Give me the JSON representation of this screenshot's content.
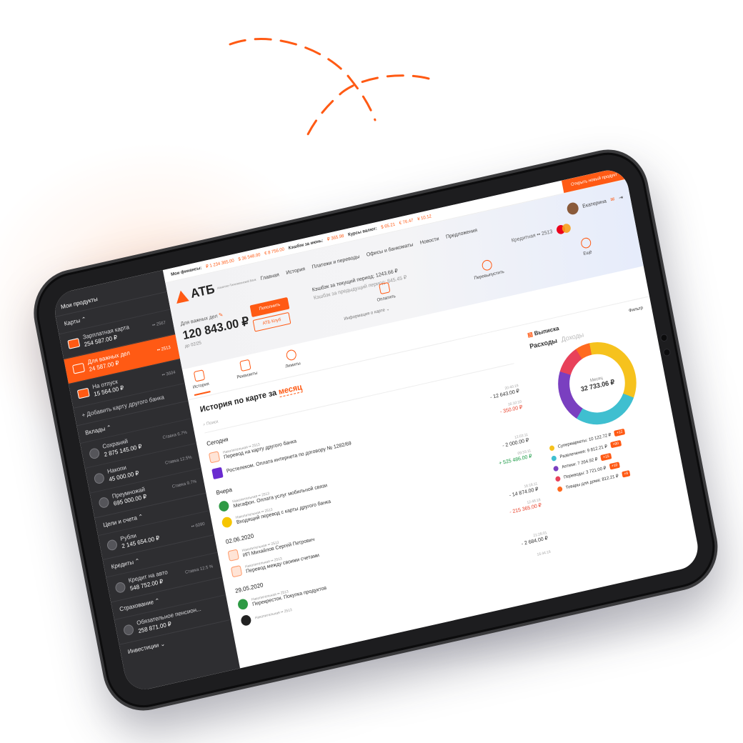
{
  "colors": {
    "accent": "#ff5a14",
    "positive": "#1b9a45",
    "negative": "#e8412b"
  },
  "topbar": {
    "finances_label": "Мои финансы:",
    "fin_1": "₽ 1 234 365.00",
    "fin_2": "$ 36 548.00",
    "fin_3": "€ 8 756.00",
    "cashback_label": "Кэшбэк за июнь:",
    "cashback_value": "₽ 365.98",
    "rates_label": "Курсы валют:",
    "rate_1": "$ 65.21",
    "rate_2": "€ 76.47",
    "rate_3": "¥ 10.12",
    "open_product": "Открыть новый продукт"
  },
  "nav": {
    "logo": "АТБ",
    "logo_sub": "Азиатско-Тихоокеанский Банк",
    "items": [
      "Главная",
      "История",
      "Платежи и переводы",
      "Офисы и банкоматы",
      "Новости",
      "Предложения"
    ],
    "user": "Екатерина"
  },
  "sidebar": {
    "title": "Мои продукты",
    "cards_header": "Карты",
    "cards": [
      {
        "name": "Зарплатная карта",
        "amount": "254 587.00 ₽",
        "num": "•• 2567"
      },
      {
        "name": "Для важных дел",
        "amount": "24 587.00 ₽",
        "num": "•• 2513"
      },
      {
        "name": "На отпуск",
        "amount": "15 564.00 ₽",
        "num": "•• 3604"
      }
    ],
    "add_card": "+ Добавить карту другого банка",
    "deposits_header": "Вклады",
    "deposits": [
      {
        "name": "Сохраняй",
        "amount": "2 875 145.00 ₽",
        "rate": "Ставка 6.7%"
      },
      {
        "name": "Накопи",
        "amount": "45 000.00 ₽",
        "rate": "Ставка 12.5%"
      },
      {
        "name": "Преумножай",
        "amount": "695 000.00 ₽",
        "rate": "Ставка 9.7%"
      }
    ],
    "goals_header": "Цели и счета",
    "goals": [
      {
        "name": "Рубли",
        "amount": "2 145 654.00 ₽",
        "num": "•• 6090"
      }
    ],
    "credits_header": "Кредиты",
    "credits": [
      {
        "name": "Кредит на авто",
        "amount": "548 752.00 ₽",
        "rate": "Ставка 12.5 %"
      }
    ],
    "insurance_header": "Страхование",
    "insurance": [
      {
        "name": "Обязательное пенсион...",
        "amount": "258 871.00 ₽"
      }
    ],
    "investments_header": "Инвестиции"
  },
  "card": {
    "name": "Для важных дел",
    "balance": "120 843.00 ₽",
    "valid": "до 02/25",
    "topup": "Пополнить",
    "club": "АТБ Клуб",
    "cashback_current": "Кэшбэк за текущий период: 1243.66 ₽",
    "cashback_prev": "Кэшбэк за предыдущий период: 845.45 ₽",
    "info": "Информация о карте",
    "credit_label": "Кредитная •• 2513"
  },
  "actions": [
    "Оплатить",
    "Перевыпустить",
    "Ещё"
  ],
  "tabs": [
    "История",
    "Реквизиты",
    "Лимиты"
  ],
  "history": {
    "title": "История по карте за",
    "period": "месяц",
    "statement": "Выписка",
    "filter": "Фильтр",
    "search_placeholder": "Поиск",
    "groups": [
      {
        "day": "Сегодня",
        "tx": [
          {
            "meta": "Накопительная •• 2513",
            "title": "Перевод на карту другого банка",
            "time": "20:40:19",
            "amount": "- 12 643.00 ₽",
            "cls": "neg",
            "ic": ""
          },
          {
            "meta": "",
            "title": "Ростелеком. Оплата интернета по договору № 1282/69",
            "time": "16:10:10",
            "amount": "- 350.00 ₽",
            "cls": "red",
            "ic": "p"
          }
        ]
      },
      {
        "day": "Вчера",
        "tx": [
          {
            "meta": "Накопительная •• 2513",
            "title": "Мегафон. Оплата услуг мобильной связи",
            "time": "12:03:11",
            "amount": "- 2 000.00 ₽",
            "cls": "neg",
            "ic": "g"
          },
          {
            "meta": "Накопительная •• 2513",
            "title": "Входящий перевод с карты другого банка",
            "time": "09:33:11",
            "amount": "+ 525 486.00 ₽",
            "cls": "grn",
            "ic": "y"
          }
        ]
      },
      {
        "day": "02.06.2020",
        "tx": [
          {
            "meta": "Накопительная •• 2513",
            "title": "ИП Михайлов Сергей Петрович",
            "time": "16:18:11",
            "amount": "- 14 874.00 ₽",
            "cls": "neg",
            "ic": ""
          },
          {
            "meta": "Накопительная •• 2513",
            "title": "Перевод между своими счетами",
            "time": "12:48:18",
            "amount": "- 215 365.00 ₽",
            "cls": "red",
            "ic": ""
          }
        ]
      },
      {
        "day": "29.05.2020",
        "tx": [
          {
            "meta": "Накопительная •• 2513",
            "title": "Перекресток. Покупка продуктов",
            "time": "21:28:01",
            "amount": "- 2 684.00 ₽",
            "cls": "neg",
            "ic": "g"
          },
          {
            "meta": "Накопительная •• 2513",
            "title": "",
            "time": "16:44:18",
            "amount": "",
            "cls": "neg",
            "ic": "k"
          }
        ]
      }
    ]
  },
  "expenses": {
    "title": "Расходы",
    "income_tab": "Доходы",
    "period": "Месяц",
    "total": "32 733.06 ₽",
    "categories": [
      {
        "name": "Супермаркеты: 10 122.72 ₽",
        "badge": "+12",
        "color": "#f6c21d",
        "share": 0.34
      },
      {
        "name": "Развлечения: 9 812.21 ₽",
        "badge": "+90",
        "color": "#3fbfd0",
        "share": 0.28
      },
      {
        "name": "Аптеки: 7 264.92 ₽",
        "badge": "+15",
        "color": "#7a3fc0",
        "share": 0.21
      },
      {
        "name": "Переводы: 3 721.00 ₽",
        "badge": "+10",
        "color": "#e8415a",
        "share": 0.11
      },
      {
        "name": "Товары для дома: 812.21 ₽",
        "badge": "+8",
        "color": "#ff6a1f",
        "share": 0.06
      }
    ]
  }
}
